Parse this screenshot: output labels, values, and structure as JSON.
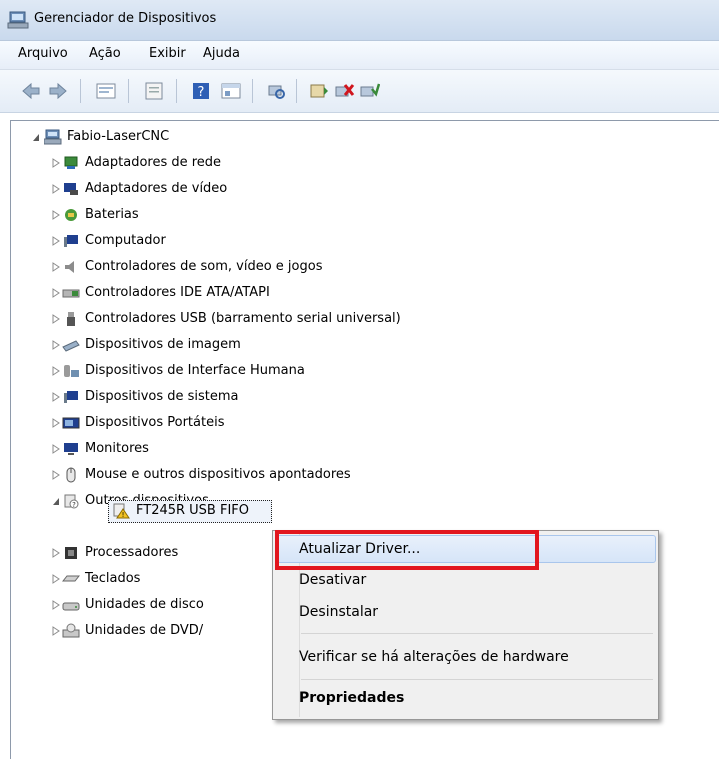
{
  "window": {
    "title": "Gerenciador de Dispositivos"
  },
  "menu": [
    "Arquivo",
    "Ação",
    "Exibir",
    "Ajuda"
  ],
  "toolbar": {
    "buttons": [
      "back-icon",
      "forward-icon",
      "tree-view-icon",
      "properties-icon",
      "help-icon",
      "details-icon",
      "scan-hardware-icon",
      "update-driver-icon",
      "uninstall-icon",
      "enable-icon"
    ]
  },
  "tree": {
    "root": "Fabio-LaserCNC",
    "categories": [
      "Adaptadores de rede",
      "Adaptadores de vídeo",
      "Baterias",
      "Computador",
      "Controladores de som, vídeo e jogos",
      "Controladores IDE ATA/ATAPI",
      "Controladores USB (barramento serial universal)",
      "Dispositivos de imagem",
      "Dispositivos de Interface Humana",
      "Dispositivos de sistema",
      "Dispositivos Portáteis",
      "Monitores",
      "Mouse e outros dispositivos apontadores",
      "Outros dispositivos"
    ],
    "child_device": "FT245R USB FIFO",
    "after": [
      "Processadores",
      "Teclados",
      "Unidades de disco",
      "Unidades de DVD/"
    ]
  },
  "context_menu": {
    "items": [
      "Atualizar Driver...",
      "Desativar",
      "Desinstalar",
      "Verificar se há alterações de hardware",
      "Propriedades"
    ]
  },
  "colors": {
    "highlight": "#e2161e",
    "title_bg": "#dfe9f5"
  }
}
